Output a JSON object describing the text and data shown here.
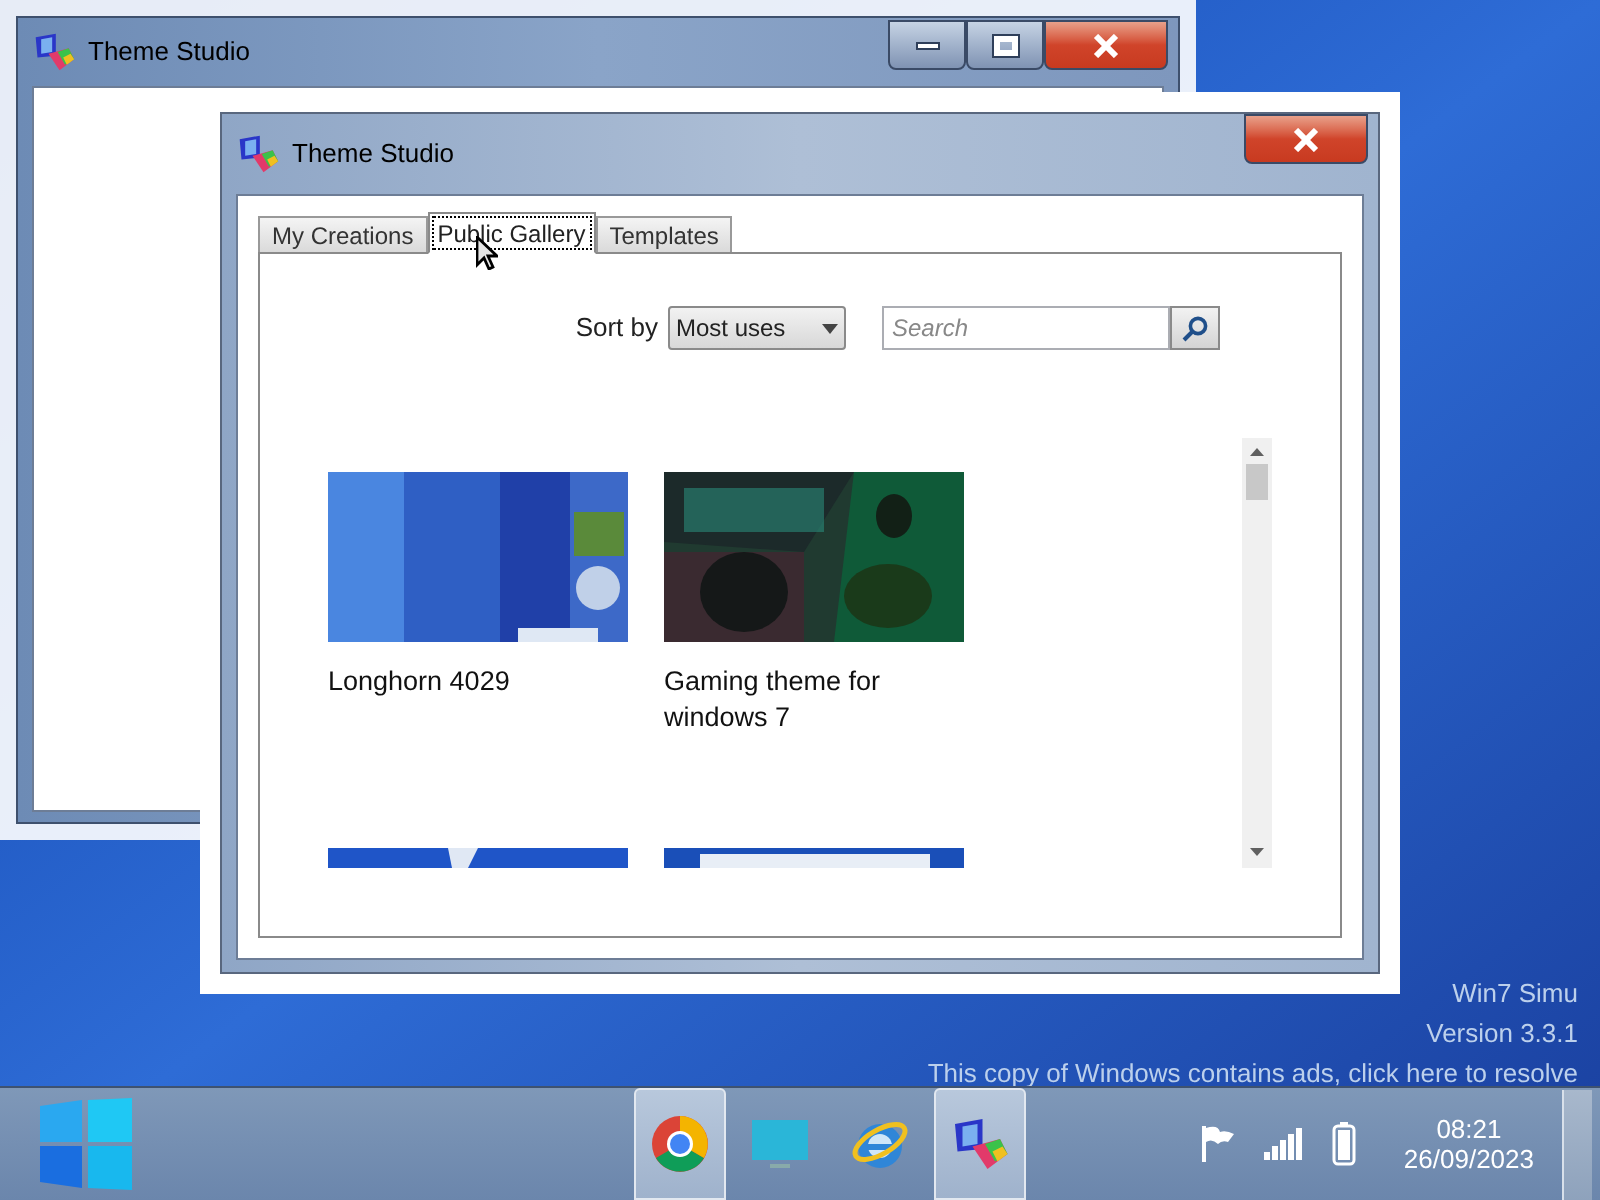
{
  "back_window": {
    "title": "Theme Studio",
    "buttons": [
      {
        "kind": "minimize"
      },
      {
        "kind": "maximize"
      },
      {
        "kind": "close"
      }
    ]
  },
  "front_window": {
    "title": "Theme Studio",
    "close": {
      "kind": "close"
    },
    "tabs": [
      {
        "label": "My Creations",
        "selected": false
      },
      {
        "label": "Public Gallery",
        "selected": true
      },
      {
        "label": "Templates",
        "selected": false
      }
    ],
    "sort": {
      "label": "Sort by",
      "value": "Most uses"
    },
    "search": {
      "placeholder": "Search"
    },
    "gallery": {
      "items": [
        {
          "title": "Longhorn 4029",
          "kind": "desktop"
        },
        {
          "title": "Gaming theme for windows 7",
          "kind": "gaming"
        },
        {
          "kind": "map"
        },
        {
          "kind": "window"
        }
      ]
    }
  },
  "desktop_notice": [
    "Win7 Simu",
    "Version 3.3.1",
    "This copy of Windows contains ads, click here to resolve"
  ],
  "taskbar": {
    "apps": [
      {
        "kind": "browser",
        "selected": true
      },
      {
        "kind": "monitor",
        "selected": false
      },
      {
        "kind": "explorer",
        "selected": false
      },
      {
        "kind": "studio",
        "selected": true
      }
    ],
    "clock": {
      "time": "08:21",
      "date": "26/09/2023"
    }
  }
}
